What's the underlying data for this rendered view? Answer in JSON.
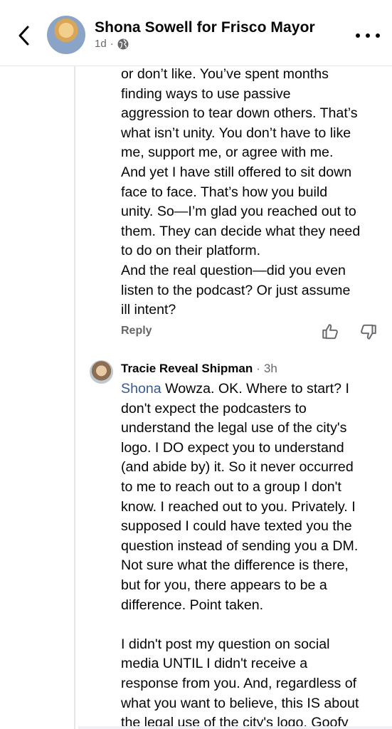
{
  "header": {
    "page_title": "Shona Sowell for Frisco Mayor",
    "time": "1d",
    "separator": "·"
  },
  "first_comment": {
    "text": "or don’t like. You’ve spent months\nfinding ways to use passive\naggression to tear down others. That’s\nwhat isn’t unity. You don’t have to like\nme, support me, or agree with me.\nAnd yet I have still offered to sit down\nface to face. That’s how you build\nunity. So—I’m glad you reached out to\nthem. They can decide what they need\nto do on their platform.\nAnd the real question—did you even\nlisten to the podcast? Or just assume\nill intent?",
    "reply_label": "Reply"
  },
  "second_comment": {
    "author": "Tracie Reveal Shipman",
    "separator": "·",
    "time": "3h",
    "mention": "Shona",
    "text_first_line": " Wowza. OK. Where to start? I",
    "text_rest": "don't expect the podcasters to\nunderstand the legal use of the city's\nlogo. I DO expect you to understand\n(and abide by) it. So it never occurred\nto me to reach out to a group I don't\nknow. I reached out to you. Privately. I\nsupposed I could have texted you the\nquestion instead of sending you a DM.\nNot sure what the difference is there,\nbut for you, there appears to be a\ndifference. Point taken.\n\nI didn't post my question on social\nmedia UNTIL I didn't receive a\nresponse from you. And, regardless of\nwhat you want to believe, this IS about\nthe legal use of the city's logo. Goofy"
  },
  "icons": {
    "back": "chevron-left-icon",
    "globe": "globe-icon",
    "more": "more-horizontal-icon",
    "like": "thumbs-up-icon",
    "dislike": "thumbs-down-icon"
  }
}
